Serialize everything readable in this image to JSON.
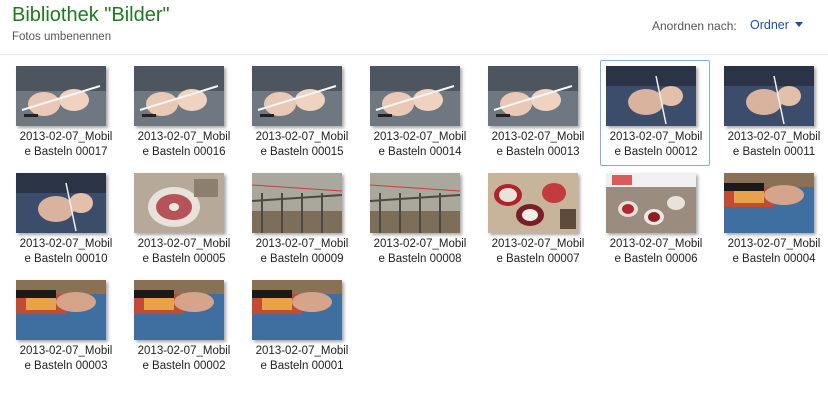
{
  "header": {
    "title": "Bibliothek \"Bilder\"",
    "subtitle": "Fotos umbenennen",
    "arrange_label": "Anordnen nach:",
    "arrange_value": "Ordner"
  },
  "files": [
    {
      "line1": "2013-02-07_Mobil",
      "line2": "e Basteln 00017",
      "scene": "hands-light",
      "selected": false
    },
    {
      "line1": "2013-02-07_Mobil",
      "line2": "e Basteln 00016",
      "scene": "hands-light",
      "selected": false
    },
    {
      "line1": "2013-02-07_Mobil",
      "line2": "e Basteln 00015",
      "scene": "hands-light",
      "selected": false
    },
    {
      "line1": "2013-02-07_Mobil",
      "line2": "e Basteln 00014",
      "scene": "hands-light",
      "selected": false
    },
    {
      "line1": "2013-02-07_Mobil",
      "line2": "e Basteln 00013",
      "scene": "hands-light",
      "selected": false
    },
    {
      "line1": "2013-02-07_Mobil",
      "line2": "e Basteln 00012",
      "scene": "hands-blue",
      "selected": true
    },
    {
      "line1": "2013-02-07_Mobil",
      "line2": "e Basteln 00011",
      "scene": "hands-blue",
      "selected": false
    },
    {
      "line1": "2013-02-07_Mobil",
      "line2": "e Basteln 00010",
      "scene": "hands-blue",
      "selected": false
    },
    {
      "line1": "2013-02-07_Mobil",
      "line2": "e Basteln 00005",
      "scene": "disc",
      "selected": false
    },
    {
      "line1": "2013-02-07_Mobil",
      "line2": "e Basteln 00009",
      "scene": "bed",
      "selected": false
    },
    {
      "line1": "2013-02-07_Mobil",
      "line2": "e Basteln 00008",
      "scene": "bed",
      "selected": false
    },
    {
      "line1": "2013-02-07_Mobil",
      "line2": "e Basteln 00007",
      "scene": "discs-red",
      "selected": false
    },
    {
      "line1": "2013-02-07_Mobil",
      "line2": "e Basteln 00006",
      "scene": "table",
      "selected": false
    },
    {
      "line1": "2013-02-07_Mobil",
      "line2": "e Basteln 00004",
      "scene": "mat",
      "selected": false
    },
    {
      "line1": "2013-02-07_Mobil",
      "line2": "e Basteln 00003",
      "scene": "mat",
      "selected": false
    },
    {
      "line1": "2013-02-07_Mobil",
      "line2": "e Basteln 00002",
      "scene": "mat",
      "selected": false
    },
    {
      "line1": "2013-02-07_Mobil",
      "line2": "e Basteln 00001",
      "scene": "mat",
      "selected": false
    }
  ],
  "colors": {
    "title": "#1e7a1e",
    "link": "#1e4f9c",
    "selection": "#84acdd"
  }
}
